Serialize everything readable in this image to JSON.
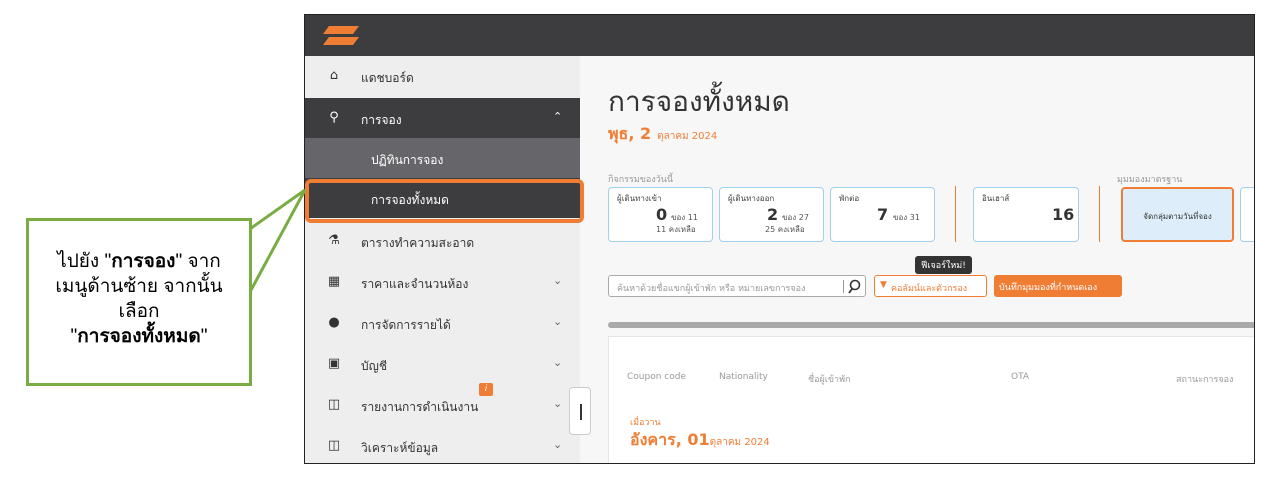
{
  "sidebar": {
    "items": [
      {
        "label": "แดชบอร์ด",
        "icon": "home-icon"
      },
      {
        "label": "การจอง",
        "icon": "key-icon"
      },
      {
        "label": "ปฏิทินการจอง"
      },
      {
        "label": "การจองทั้งหมด"
      },
      {
        "label": "ตารางทำความสะอาด",
        "icon": "cleaning-icon"
      },
      {
        "label": "ราคาและจำนวนห้อง",
        "icon": "calendar-icon"
      },
      {
        "label": "การจัดการรายได้",
        "icon": "dollar-icon"
      },
      {
        "label": "บัญชี",
        "icon": "wallet-icon"
      },
      {
        "label": "รายงานการดำเนินงาน",
        "icon": "report-icon"
      },
      {
        "label": "วิเคราะห์ข้อมูล",
        "icon": "report-icon"
      }
    ],
    "badge": "i"
  },
  "main": {
    "title": "การจองทั้งหมด",
    "date_big": "พุธ, 2",
    "date_small": "ตุลาคม 2024",
    "today_label": "กิจกรรมของวันนี้",
    "standard_view_label": "มุมมองมาตรฐาน",
    "cards": {
      "arrivals": {
        "title": "ผู้เดินทางเข้า",
        "value": "0",
        "of": "ของ 11",
        "remaining": "11 คงเหลือ"
      },
      "departures": {
        "title": "ผู้เดินทางออก",
        "value": "2",
        "of": "ของ 27",
        "remaining": "25 คงเหลือ"
      },
      "stay": {
        "title": "พักต่อ",
        "value": "7",
        "of": "ของ 31"
      },
      "inhouse": {
        "title": "อินเฮาส์",
        "value": "16"
      },
      "group_by_date": "จัดกลุ่มตามวันที่จอง"
    },
    "tooltip": "ฟีเจอร์ใหม่!",
    "search_placeholder": "ค้นหาด้วยชื่อแขกผู้เข้าพัก หรือ หมายเลขการจอง",
    "filter_button": "คอลัมน์และตัวกรอง",
    "save_view_button": "บันทึกมุมมองที่กำหนดเอง",
    "columns": [
      "Coupon code",
      "Nationality",
      "ชื่อผู้เข้าพัก",
      "OTA",
      "สถานะการจอง"
    ],
    "group": {
      "label": "เมื่อวาน",
      "date_big": "อังคาร, 01",
      "date_small": "ตุลาคม 2024"
    }
  },
  "callout": {
    "line1_prefix": "ไปยัง \"",
    "line1_bold": "การจอง",
    "line1_suffix": "\" จาก",
    "line2": "เมนูด้านซ้าย จากนั้น",
    "line3": "เลือก",
    "line4_prefix": "\"",
    "line4_bold": "การจองทั้งหมด",
    "line4_suffix": "\""
  },
  "colors": {
    "accent": "#f07d34",
    "callout_border": "#79ad43",
    "topbar": "#3d3d3f"
  }
}
